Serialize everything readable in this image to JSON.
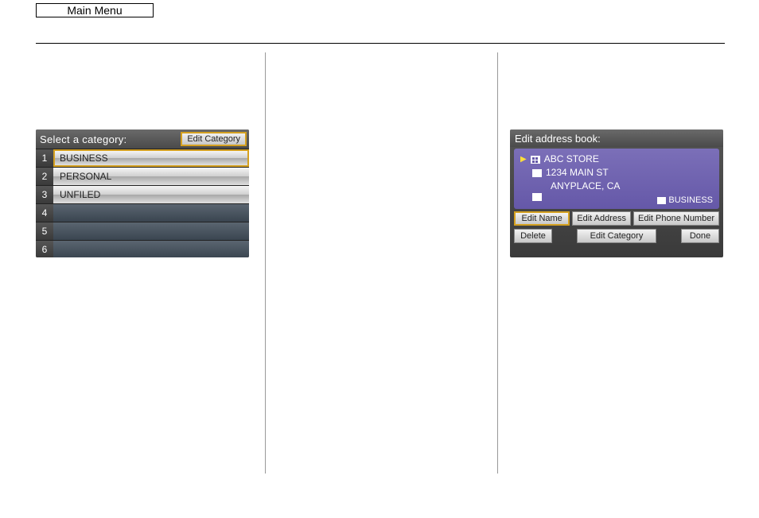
{
  "main_menu": "Main Menu",
  "screen1": {
    "title": "Select a category:",
    "edit_category": "Edit Category",
    "rows": [
      {
        "num": "1",
        "label": "BUSINESS",
        "filled": true,
        "selected": true
      },
      {
        "num": "2",
        "label": "PERSONAL",
        "filled": true,
        "selected": false
      },
      {
        "num": "3",
        "label": "UNFILED",
        "filled": true,
        "selected": false
      },
      {
        "num": "4",
        "label": "",
        "filled": false,
        "selected": false
      },
      {
        "num": "5",
        "label": "",
        "filled": false,
        "selected": false
      },
      {
        "num": "6",
        "label": "",
        "filled": false,
        "selected": false
      }
    ]
  },
  "screen2": {
    "title": "Edit address book:",
    "entry": {
      "name": "ABC STORE",
      "address1": "1234 MAIN ST",
      "address2": "ANYPLACE, CA",
      "category_icon": "folder-icon",
      "category": "BUSINESS"
    },
    "buttons": {
      "edit_name": "Edit Name",
      "edit_address": "Edit Address",
      "edit_phone": "Edit Phone Number",
      "delete": "Delete",
      "edit_category": "Edit Category",
      "done": "Done"
    }
  }
}
